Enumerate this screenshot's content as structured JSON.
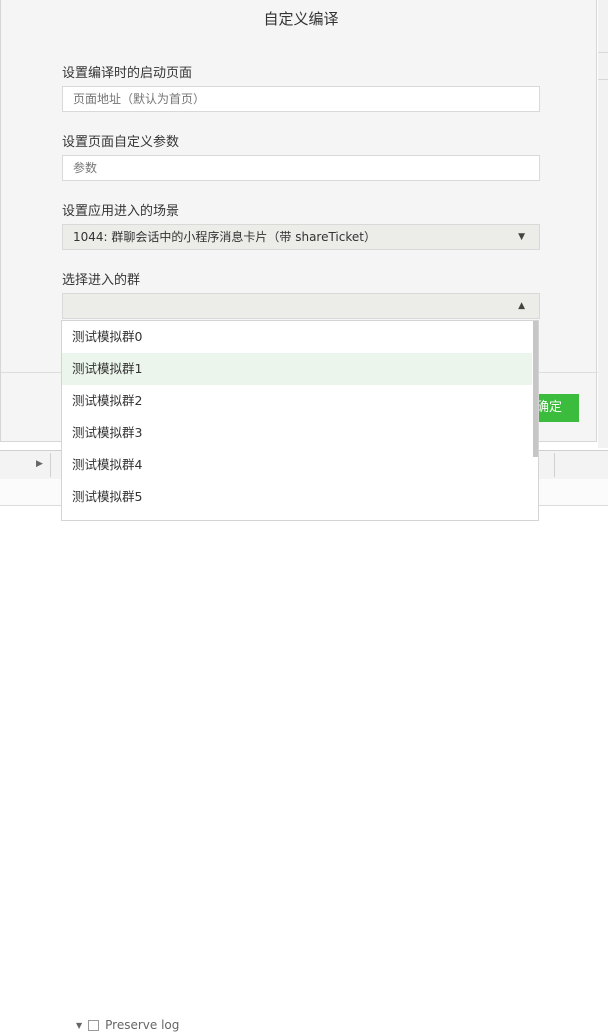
{
  "dialog": {
    "title": "自定义编译",
    "fields": {
      "launch_page": {
        "label": "设置编译时的启动页面",
        "placeholder": "页面地址（默认为首页）",
        "value": ""
      },
      "params": {
        "label": "设置页面自定义参数",
        "placeholder": "参数",
        "value": ""
      },
      "scene": {
        "label": "设置应用进入的场景",
        "value": "1044: 群聊会话中的小程序消息卡片（带 shareTicket）"
      },
      "group": {
        "label": "选择进入的群",
        "value": ""
      }
    },
    "group_options": [
      "测试模拟群0",
      "测试模拟群1",
      "测试模拟群2",
      "测试模拟群3",
      "测试模拟群4",
      "测试模拟群5"
    ],
    "confirm_label": "确定"
  },
  "console": {
    "preserve_log_label": "Preserve log"
  }
}
